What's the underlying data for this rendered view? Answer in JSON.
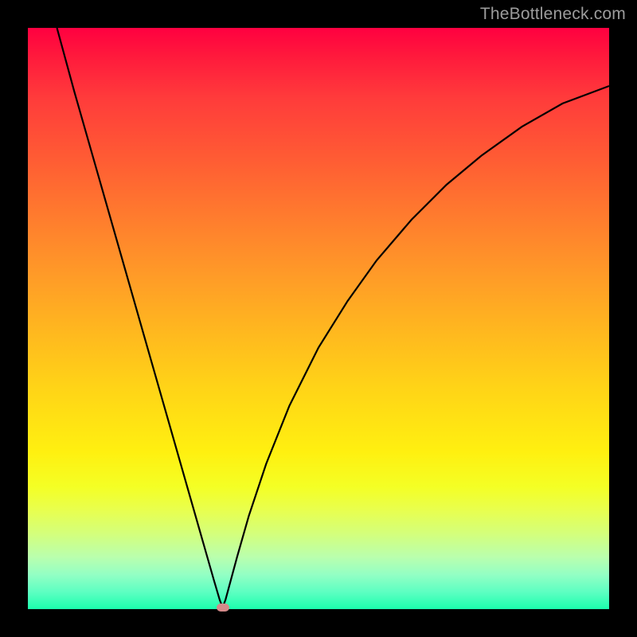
{
  "watermark": "TheBottleneck.com",
  "colors": {
    "frame": "#000000",
    "gradient_top": "#ff0040",
    "gradient_bottom": "#1bffad",
    "curve": "#000000",
    "marker": "#d48a8a",
    "watermark_text": "#9c9c9c"
  },
  "chart_data": {
    "type": "line",
    "title": "",
    "xlabel": "",
    "ylabel": "",
    "xlim": [
      0,
      100
    ],
    "ylim": [
      0,
      100
    ],
    "grid": false,
    "legend": false,
    "note": "V-shaped bottleneck curve. Minimum (optimal point) marked.",
    "series": [
      {
        "name": "bottleneck-curve",
        "x": [
          5,
          8,
          12,
          16,
          20,
          24,
          28,
          30,
          32,
          33,
          33.5,
          34,
          36,
          38,
          41,
          45,
          50,
          55,
          60,
          66,
          72,
          78,
          85,
          92,
          100
        ],
        "y": [
          100,
          89,
          75,
          61,
          47,
          33,
          19,
          12,
          5,
          1.6,
          0.3,
          1.6,
          9,
          16,
          25,
          35,
          45,
          53,
          60,
          67,
          73,
          78,
          83,
          87,
          90
        ]
      }
    ],
    "marker": {
      "x": 33.5,
      "y": 0.3
    }
  }
}
